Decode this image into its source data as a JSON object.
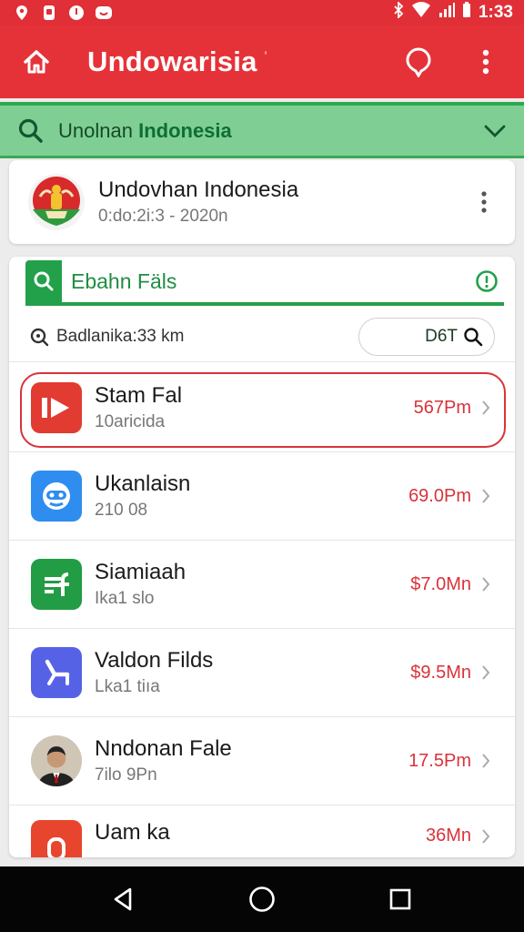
{
  "status_bar": {
    "time": "1:33"
  },
  "app_bar": {
    "title": "Undowarisia",
    "title_mark": "ʼ"
  },
  "green_search": {
    "label_prefix": "Unolnan",
    "label_main": "Indonesia"
  },
  "profile": {
    "name": "Undovhan Indonesia",
    "date": "0:do:2i:3 - 2020n"
  },
  "file_search": {
    "label": "Ebahn Fäls"
  },
  "filter": {
    "text": "Badlanika:33 km",
    "pill_value": "D6T"
  },
  "rows": [
    {
      "title": "Stam Fal",
      "subtitle": "10aricida",
      "amount": "567Pm",
      "icon": "play-icon",
      "color": "#e23b32",
      "selected": true
    },
    {
      "title": "Ukanlaisn",
      "subtitle": "210 08",
      "amount": "69.0Pm",
      "icon": "face-icon",
      "color": "#2f8df0",
      "selected": false
    },
    {
      "title": "Siamiaah",
      "subtitle": "Ika1 slo",
      "amount": "$7.0Mn",
      "icon": "sheet-icon",
      "color": "#229c45",
      "selected": false
    },
    {
      "title": "Valdon Filds",
      "subtitle": "Lka1 tiıa",
      "amount": "$9.5Mn",
      "icon": "chair-icon",
      "color": "#5562e6",
      "selected": false
    },
    {
      "title": "Nndonan Fale",
      "subtitle": "7ilo 9Pn",
      "amount": "17.5Pm",
      "icon": "person-avatar",
      "color": "#8a6a50",
      "selected": false
    },
    {
      "title": "Uam ka",
      "subtitle": "",
      "amount": "36Mn",
      "icon": "app-icon-red",
      "color": "#e8452f",
      "selected": false
    }
  ],
  "colors": {
    "primary_red": "#e53238",
    "green": "#23a04a",
    "amount_red": "#d8333a"
  }
}
